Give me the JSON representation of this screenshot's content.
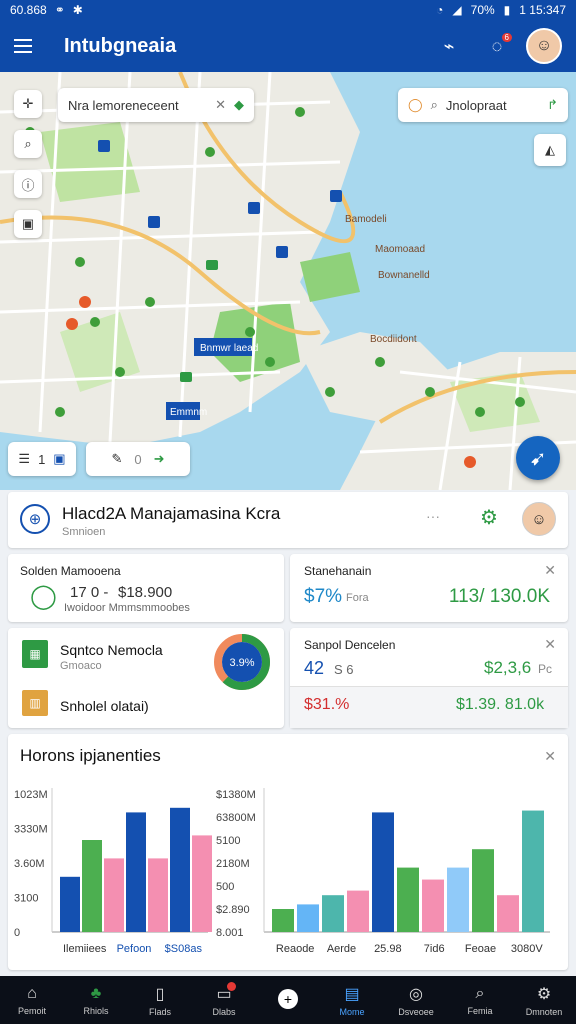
{
  "status": {
    "time_left": "60.868",
    "time_right": "1 15:347",
    "battery": "70%"
  },
  "appbar": {
    "title": "Intubgneaia",
    "notif_count": "6"
  },
  "map": {
    "search_left_text": "Nra lemoreneceent",
    "search_right_text": "Jnolopraat",
    "left_panel_label": "1",
    "right_panel_label": "0",
    "pin_labels": [
      "Bamodeli",
      "Maomoaad",
      "Bownanelld",
      "Bocdiidont"
    ],
    "blue_label_1": "Bnmwr laead",
    "blue_label_2": "Emmnm"
  },
  "header_card": {
    "title": "Hlacd2A Manajamasina Kcra",
    "subtitle": "Smnioen"
  },
  "card_a": {
    "title": "Solden Mamooena",
    "value1": "17 0 -",
    "value2": "$18.900",
    "sub": "Iwoidoor Mmmsmmoobes"
  },
  "card_b": {
    "title": "Stanehanain",
    "pct": "$7%",
    "unit": "Fora",
    "value": "113/ 130.0K"
  },
  "card_c": {
    "title": "Sqntco Nemocla",
    "subtitle": "Gmoaco",
    "footer": "Snholel olatai)",
    "donut_label": "3.9%",
    "donut_value": 0.62
  },
  "card_d": {
    "title": "Sanpol Dencelen",
    "v1": "42",
    "v2": "S 6",
    "v3": "$2,3,6",
    "v3_unit": "Pc",
    "v4": "$31.%",
    "v5": "$1.39. 81.0k"
  },
  "colors": {
    "brand": "#0e4aa8",
    "green": "#2e9a44",
    "red": "#d32f2f",
    "teal": "#3fa7a0"
  },
  "chart_data": [
    {
      "type": "bar",
      "title": "Horons ipjanenties",
      "yticks": [
        "1023M",
        "3330M",
        "3.60M",
        "3100",
        "0"
      ],
      "categories": [
        "Ilemiiees",
        "Pefoon",
        "$S08as"
      ],
      "series": [
        {
          "color": "#1450b0",
          "values": [
            60,
            120,
            130
          ]
        },
        {
          "color": "#4caf50",
          "values": [
            100,
            0,
            0
          ]
        },
        {
          "color": "#f48fb1",
          "values": [
            80,
            80,
            100
          ]
        }
      ],
      "bars": [
        {
          "value": 60,
          "color": "#1450b0"
        },
        {
          "value": 100,
          "color": "#4caf50"
        },
        {
          "value": 80,
          "color": "#f48fb1"
        },
        {
          "value": 130,
          "color": "#1450b0"
        },
        {
          "value": 80,
          "color": "#f48fb1"
        },
        {
          "value": 135,
          "color": "#1450b0"
        },
        {
          "value": 105,
          "color": "#f48fb1"
        }
      ],
      "ylim": [
        0,
        150
      ]
    },
    {
      "type": "bar",
      "yticks": [
        "$1380M",
        "63800M",
        "5100",
        "2180M",
        "500",
        "$2.890",
        "8.001"
      ],
      "categories": [
        "Reaode",
        "Aerde",
        "25.98",
        "7id6",
        "Feoae",
        "3080V"
      ],
      "bars": [
        {
          "value": 25,
          "color": "#4caf50"
        },
        {
          "value": 30,
          "color": "#64b5f6"
        },
        {
          "value": 40,
          "color": "#4db6ac"
        },
        {
          "value": 45,
          "color": "#f48fb1"
        },
        {
          "value": 130,
          "color": "#1450b0"
        },
        {
          "value": 70,
          "color": "#4caf50"
        },
        {
          "value": 57,
          "color": "#f48fb1"
        },
        {
          "value": 70,
          "color": "#90caf9"
        },
        {
          "value": 90,
          "color": "#4caf50"
        },
        {
          "value": 40,
          "color": "#f48fb1"
        },
        {
          "value": 132,
          "color": "#4db6ac"
        }
      ],
      "ylim": [
        0,
        150
      ]
    }
  ],
  "navbar": [
    {
      "label": "Pemoit",
      "icon": "home-icon"
    },
    {
      "label": "Rhiols",
      "icon": "people-icon"
    },
    {
      "label": "Flads",
      "icon": "book-icon"
    },
    {
      "label": "Dlabs",
      "icon": "inbox-icon"
    },
    {
      "label": "",
      "icon": "add-icon"
    },
    {
      "label": "Mome",
      "icon": "monitor-icon"
    },
    {
      "label": "Dsveoee",
      "icon": "globe-icon"
    },
    {
      "label": "Femia",
      "icon": "search-icon"
    },
    {
      "label": "Dmnoten",
      "icon": "settings-icon"
    }
  ]
}
